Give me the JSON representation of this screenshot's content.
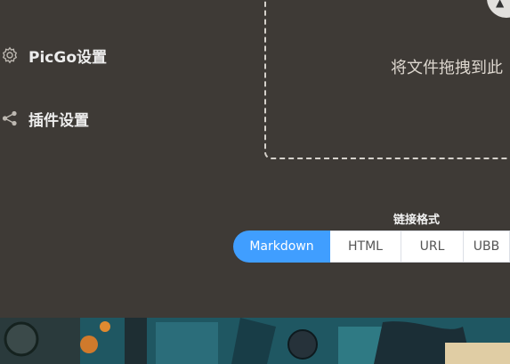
{
  "sidebar": {
    "items": [
      {
        "label": "PicGo设置",
        "icon": "gear-icon"
      },
      {
        "label": "插件设置",
        "icon": "share-icon"
      }
    ]
  },
  "upload": {
    "drop_text": "将文件拖拽到此",
    "button_icon": "upload-icon"
  },
  "link_format": {
    "title": "链接格式",
    "options": [
      "Markdown",
      "HTML",
      "URL",
      "UBB"
    ],
    "selected": "Markdown"
  },
  "colors": {
    "background": "#3e3a36",
    "accent": "#409eff"
  }
}
